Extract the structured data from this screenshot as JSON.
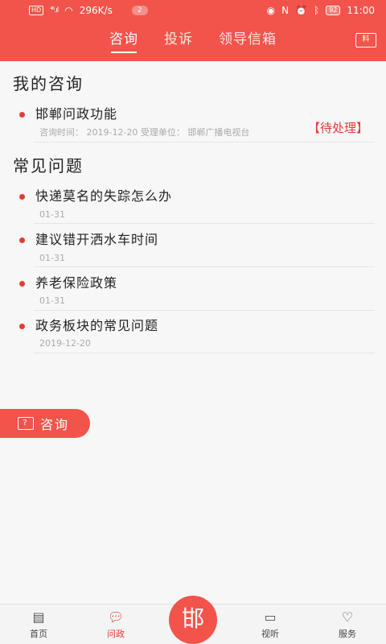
{
  "status_bar": {
    "hd": "HD",
    "signal": "⁴⁶.ıl",
    "speed": "296K/s",
    "notification_count": "2",
    "battery": "92",
    "time": "11:00"
  },
  "header": {
    "tabs": [
      {
        "label": "咨询",
        "active": true
      },
      {
        "label": "投诉",
        "active": false
      },
      {
        "label": "领导信箱",
        "active": false
      }
    ],
    "right_icon_text": "料"
  },
  "my_consult": {
    "title": "我的咨询",
    "items": [
      {
        "title": "邯郸问政功能",
        "meta": "咨询时间：  2019-12-20     受理单位：  邯郸广播电视台",
        "status": "【待处理】"
      }
    ]
  },
  "faq": {
    "title": "常见问题",
    "items": [
      {
        "title": "快递莫名的失踪怎么办",
        "date": "01-31"
      },
      {
        "title": "建议错开洒水车时间",
        "date": "01-31"
      },
      {
        "title": "养老保险政策",
        "date": "01-31"
      },
      {
        "title": "政务板块的常见问题",
        "date": "2019-12-20"
      }
    ]
  },
  "fab": {
    "label": "咨询",
    "icon_text": "?"
  },
  "bottom_nav": {
    "items": [
      {
        "label": "首页",
        "icon": "home-icon",
        "active": false
      },
      {
        "label": "问政",
        "icon": "chat-icon",
        "active": true
      },
      {
        "label": "视听",
        "icon": "tv-icon",
        "active": false
      },
      {
        "label": "服务",
        "icon": "heart-icon",
        "active": false
      }
    ],
    "center_glyph": "邯"
  },
  "colors": {
    "accent": "#f2544b",
    "status_red": "#e53b33"
  }
}
